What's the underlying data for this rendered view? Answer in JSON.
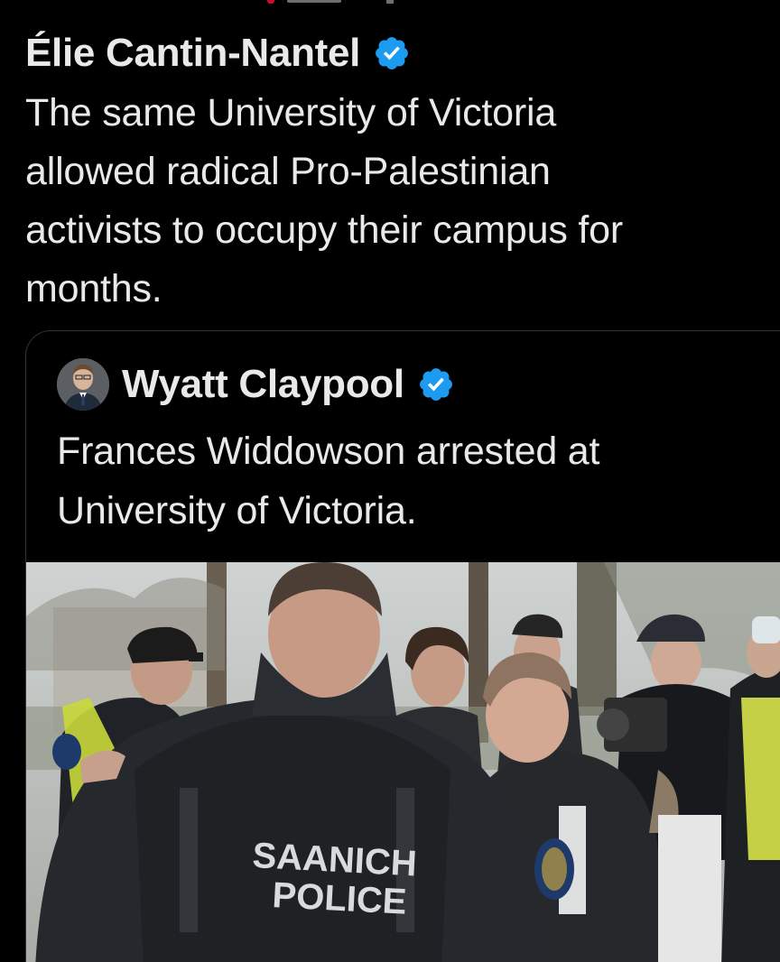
{
  "post": {
    "author_name": "Élie Cantin-Nantel",
    "verified_icon": "verified-badge-icon",
    "text_lines": [
      "The same University of Victoria",
      "allowed radical Pro-Palestinian",
      "activists to occupy their campus for",
      "months."
    ]
  },
  "quoted_post": {
    "author_name": "Wyatt Claypool",
    "verified_icon": "verified-badge-icon",
    "text_lines": [
      "Frances Widdowson arrested at",
      "University of Victoria."
    ],
    "media": {
      "kind": "video-still",
      "vest_text_line1": "SAANICH",
      "vest_text_line2": "POLICE"
    }
  },
  "colors": {
    "background": "#000000",
    "text": "#e7e9ea",
    "verified_blue": "#1d9bf0",
    "border": "#2f3336"
  }
}
